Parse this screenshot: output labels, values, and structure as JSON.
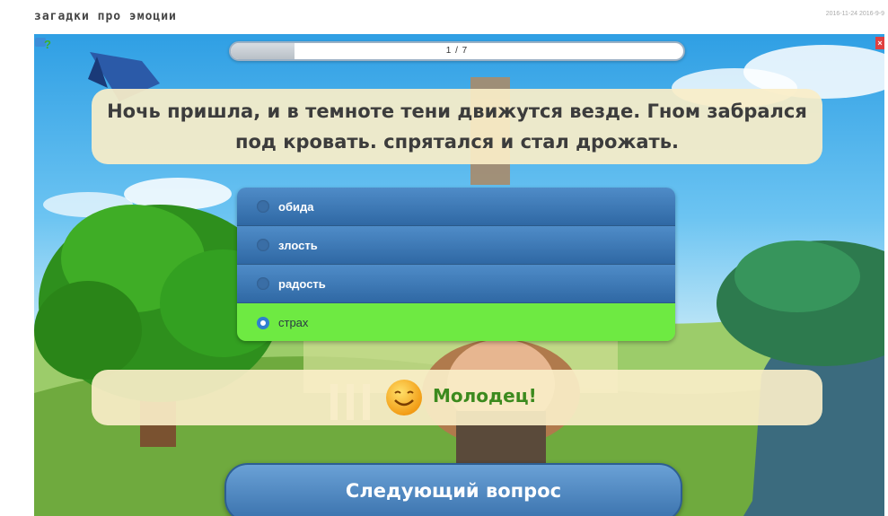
{
  "app": {
    "title": "загадки про эмоции",
    "timestamp": "2016-11-24 2016-9-9"
  },
  "progress": {
    "text": "1 / 7",
    "current": 1,
    "total": 7,
    "fraction": 0.14
  },
  "question": {
    "text": "Ночь пришла, и в темноте тени движутся везде. Гном забрался под кровать. спрятался и стал дрожать."
  },
  "answers": [
    {
      "label": "обида",
      "selected": false
    },
    {
      "label": "злость",
      "selected": false
    },
    {
      "label": "радость",
      "selected": false
    },
    {
      "label": "страх",
      "selected": true
    }
  ],
  "feedback": {
    "text": "Молодец!",
    "icon": "smiley-icon"
  },
  "next_button": {
    "label": "Следующий вопрос"
  },
  "icons": {
    "help": "help-icon",
    "close": "close-icon"
  },
  "colors": {
    "selected_answer": "#6eea42",
    "answer_bg": "#3b78b8",
    "feedback_text": "#3c8a1e",
    "button": "#4d87c3"
  }
}
